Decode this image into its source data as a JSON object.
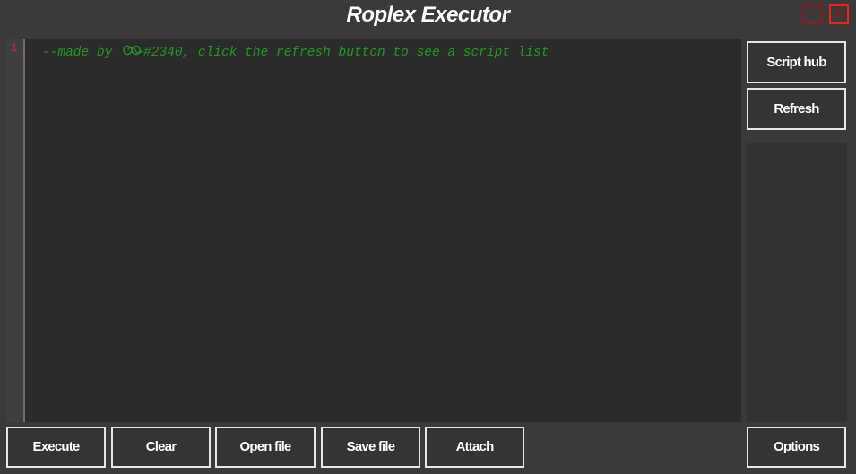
{
  "window": {
    "title": "Roplex Executor",
    "minimize_label": "-",
    "close_label": "X"
  },
  "editor": {
    "line_numbers": [
      "1"
    ],
    "code_before": "--made by ",
    "code_after": "#2340, click the refresh button to see a script list"
  },
  "sidebar": {
    "script_hub_label": "Script hub",
    "refresh_label": "Refresh",
    "options_label": "Options"
  },
  "toolbar": {
    "execute_label": "Execute",
    "clear_label": "Clear",
    "open_file_label": "Open file",
    "save_file_label": "Save file",
    "attach_label": "Attach"
  },
  "icons": {
    "author_logo": "infinity-logo-icon"
  },
  "colors": {
    "background": "#3a3a3a",
    "editor_bg": "#2b2b2b",
    "comment_green": "#1f9a1f",
    "line_number_red": "#e02020",
    "window_button_red": "#ff1a1a",
    "button_border": "#e6e6e6"
  }
}
